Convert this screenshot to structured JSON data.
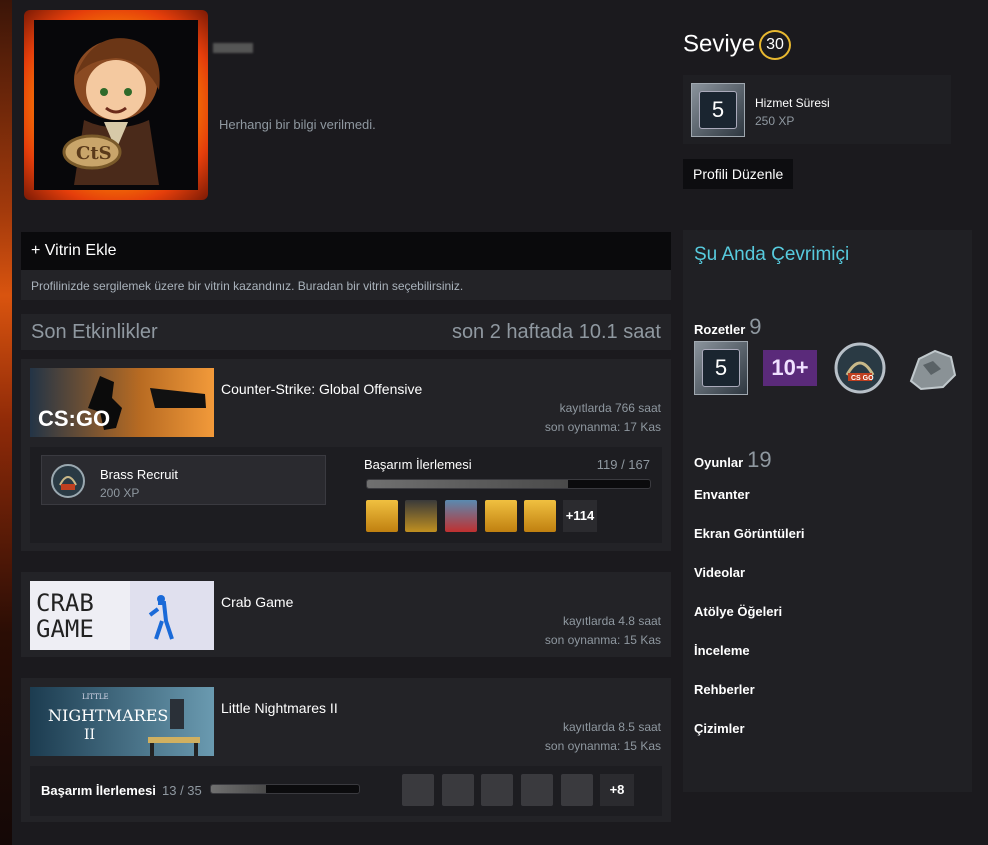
{
  "profile": {
    "summary": "Herhangi bir bilgi verilmedi.",
    "level_label": "Seviye",
    "level": "30",
    "xp_badge_number": "5",
    "xp_badge_title": "Hizmet Süresi",
    "xp_badge_xp": "250 XP",
    "edit_button": "Profili Düzenle"
  },
  "showcase": {
    "add_label": "+ Vitrin Ekle",
    "description": "Profilinizde sergilemek üzere bir vitrin kazandınız. Buradan bir vitrin seçebilirsiniz."
  },
  "recent": {
    "title": "Son Etkinlikler",
    "playtime": "son 2 haftada 10.1 saat",
    "games": [
      {
        "name": "Counter-Strike: Global Offensive",
        "hours": "kayıtlarda 766 saat",
        "last_played": "son oynanma: 17 Kas",
        "capsule_text": "CS:GO",
        "rank_name": "Brass Recruit",
        "rank_xp": "200 XP",
        "ach_label": "Başarım İlerlemesi",
        "ach_count": "119 / 167",
        "ach_progress": 0.71,
        "ach_more": "+114"
      },
      {
        "name": "Crab Game",
        "hours": "kayıtlarda 4.8 saat",
        "last_played": "son oynanma: 15 Kas",
        "capsule_line1": "CRAB",
        "capsule_line2": "GAME"
      },
      {
        "name": "Little Nightmares II",
        "hours": "kayıtlarda 8.5 saat",
        "last_played": "son oynanma: 15 Kas",
        "capsule_small": "LITTLE",
        "capsule_text": "NIGHTMARES",
        "capsule_num": "II",
        "ach_label": "Başarım İlerlemesi",
        "ach_count": "13 / 35",
        "ach_progress": 0.37,
        "ach_more": "+8"
      }
    ]
  },
  "sidebar": {
    "status": "Şu Anda Çevrimiçi",
    "badges_label": "Rozetler",
    "badges_count": "9",
    "badge_5": "5",
    "badge_10": "10+",
    "badge_csgo": "CS GO",
    "games_label": "Oyunlar",
    "games_count": "19",
    "links": [
      "Envanter",
      "Ekran Görüntüleri",
      "Videolar",
      "Atölye Öğeleri",
      "İnceleme",
      "Rehberler",
      "Çizimler"
    ]
  },
  "colors": {
    "online": "#57cbde",
    "level_ring": "#e8b830",
    "background": "#1b1a1e"
  }
}
